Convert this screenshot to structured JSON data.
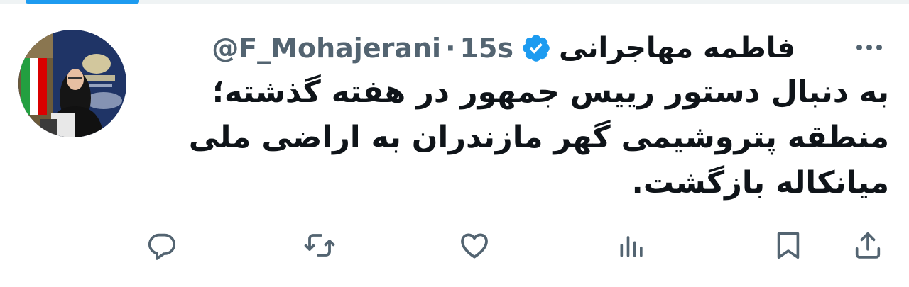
{
  "tweet": {
    "author_name": "فاطمه مهاجرانی",
    "handle": "@F_Mohajerani",
    "separator": "·",
    "time": "15s",
    "verified": true,
    "text_lines": [
      "به دنبال دستور رییس جمهور در هفته گذشته؛",
      "منطقه پتروشیمی گهر مازندران به اراضی ملی",
      "میانکاله بازگشت."
    ]
  },
  "icons": {
    "verified": "verified-badge-icon",
    "more": "more-icon",
    "reply": "reply-icon",
    "retweet": "retweet-icon",
    "like": "heart-icon",
    "views": "views-icon",
    "bookmark": "bookmark-icon",
    "share": "share-icon"
  },
  "colors": {
    "text": "#0f1419",
    "secondary": "#536471",
    "verified": "#1d9bf0",
    "accent": "#1d9bf0"
  }
}
